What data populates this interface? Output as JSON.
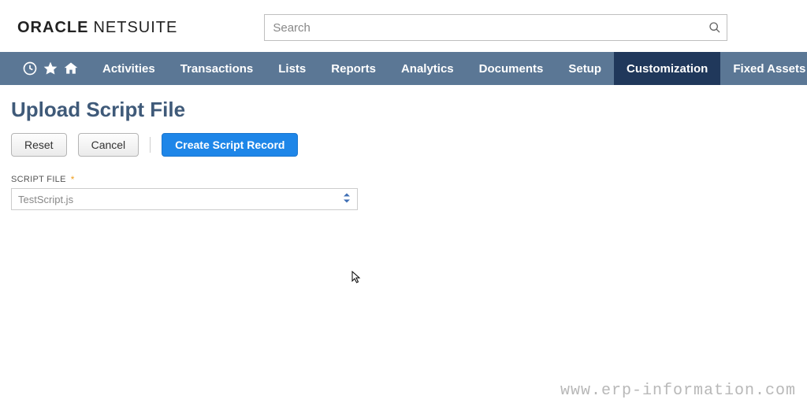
{
  "header": {
    "logo_oracle": "ORACLE",
    "logo_netsuite": "NETSUITE",
    "search_placeholder": "Search"
  },
  "nav": {
    "items": [
      {
        "label": "Activities",
        "active": false
      },
      {
        "label": "Transactions",
        "active": false
      },
      {
        "label": "Lists",
        "active": false
      },
      {
        "label": "Reports",
        "active": false
      },
      {
        "label": "Analytics",
        "active": false
      },
      {
        "label": "Documents",
        "active": false
      },
      {
        "label": "Setup",
        "active": false
      },
      {
        "label": "Customization",
        "active": true
      },
      {
        "label": "Fixed Assets",
        "active": false
      }
    ]
  },
  "page": {
    "title": "Upload Script File",
    "buttons": {
      "reset": "Reset",
      "cancel": "Cancel",
      "create": "Create Script Record"
    },
    "field": {
      "label": "SCRIPT FILE",
      "value": "TestScript.js"
    }
  },
  "watermark": "www.erp-information.com"
}
